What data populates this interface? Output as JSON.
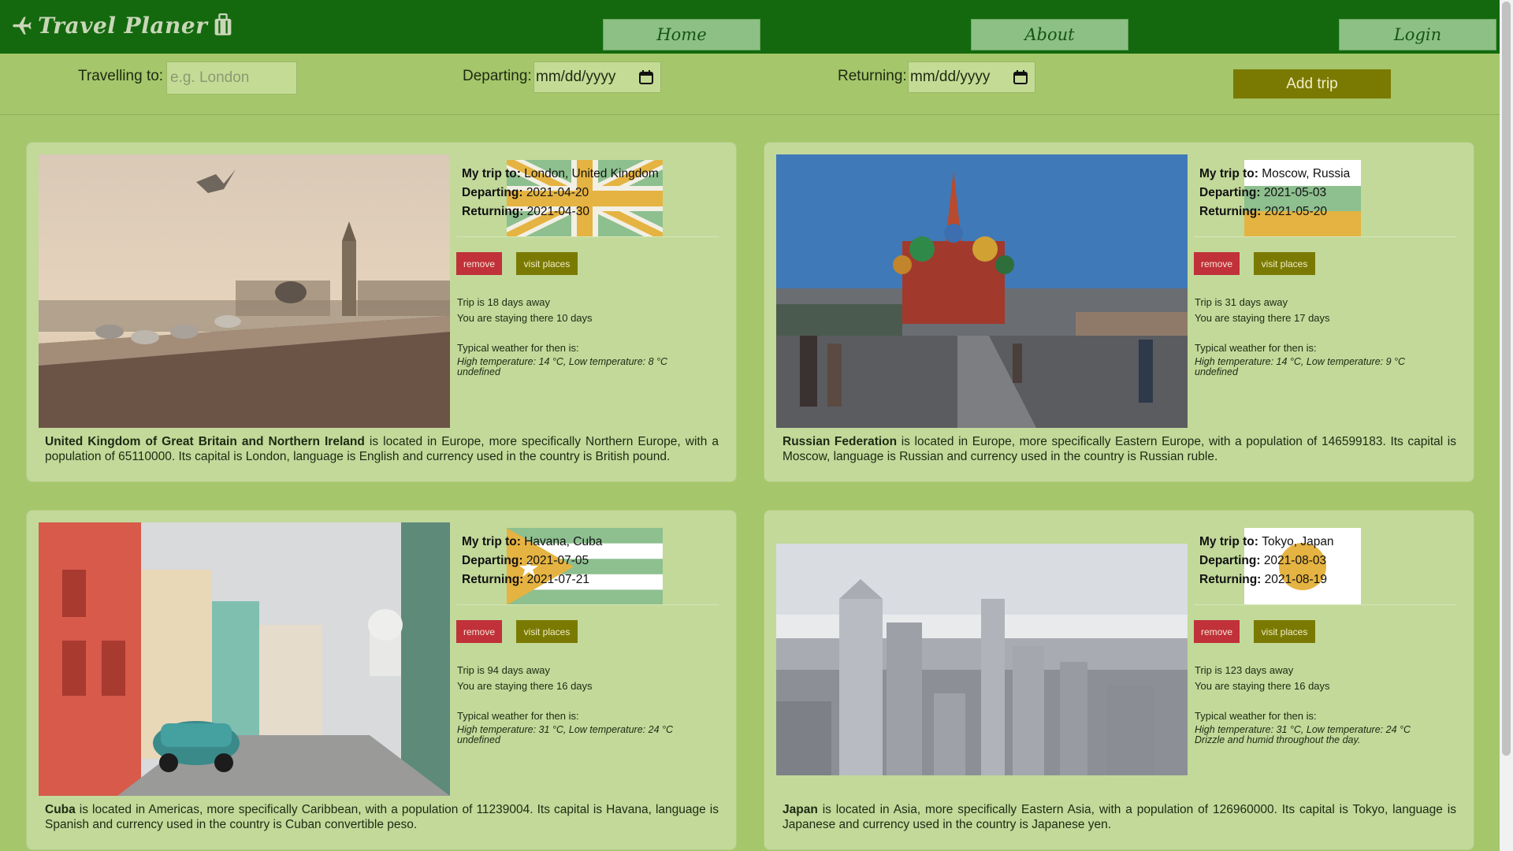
{
  "app": {
    "title": "Travel Planer"
  },
  "nav": {
    "home": "Home",
    "about": "About",
    "login": "Login"
  },
  "form": {
    "travelling_label": "Travelling to:",
    "travelling_placeholder": "e.g. London",
    "departing_label": "Departing:",
    "departing_value": "mm/dd/yyyy",
    "returning_label": "Returning:",
    "returning_value": "mm/dd/yyyy",
    "add_trip": "Add trip"
  },
  "labels": {
    "my_trip": "My trip to:",
    "departing": "Departing:",
    "returning": "Returning:",
    "remove": "remove",
    "visit_places": "visit places",
    "weather_heading": "Typical weather for then is:"
  },
  "trips": [
    {
      "destination": "London, United Kingdom",
      "departing": "2021-04-20",
      "returning": "2021-04-30",
      "away": "Trip is 18 days away",
      "staying": "You are staying there 10 days",
      "weather": "High temperature: 14 °C, Low temperature: 8 °C",
      "weather_desc": "undefined",
      "country": "United Kingdom of Great Britain and Northern Ireland",
      "description": " is located in Europe, more specifically Northern Europe, with a population of 65110000. Its capital is London, language is English and currency used in the country is British pound.",
      "flag": "uk"
    },
    {
      "destination": "Moscow, Russia",
      "departing": "2021-05-03",
      "returning": "2021-05-20",
      "away": "Trip is 31 days away",
      "staying": "You are staying there 17 days",
      "weather": "High temperature: 14 °C, Low temperature: 9 °C",
      "weather_desc": "undefined",
      "country": "Russian Federation",
      "description": " is located in Europe, more specifically Eastern Europe, with a population of 146599183. Its capital is Moscow, language is Russian and currency used in the country is Russian ruble.",
      "flag": "russia"
    },
    {
      "destination": "Havana, Cuba",
      "departing": "2021-07-05",
      "returning": "2021-07-21",
      "away": "Trip is 94 days away",
      "staying": "You are staying there 16 days",
      "weather": "High temperature: 31 °C, Low temperature: 24 °C",
      "weather_desc": "undefined",
      "country": "Cuba",
      "description": " is located in Americas, more specifically Caribbean, with a population of 11239004. Its capital is Havana, language is Spanish and currency used in the country is Cuban convertible peso.",
      "flag": "cuba"
    },
    {
      "destination": "Tokyo, Japan",
      "departing": "2021-08-03",
      "returning": "2021-08-19",
      "away": "Trip is 123 days away",
      "staying": "You are staying there 16 days",
      "weather": "High temperature: 31 °C, Low temperature: 24 °C",
      "weather_desc": "Drizzle and humid throughout the day.",
      "country": "Japan",
      "description": " is located in Asia, more specifically Eastern Asia, with a population of 126960000. Its capital is Tokyo, language is Japanese and currency used in the country is Japanese yen.",
      "flag": "japan"
    }
  ],
  "colors": {
    "header": "#14690e",
    "background": "#a5c66a",
    "card": "#c2d99a",
    "remove": "#c0313a",
    "accent": "#7a7a02",
    "flag_green": "#8dbf8f",
    "flag_gold": "#e5b341"
  },
  "icons": [
    "airplane-icon",
    "suitcase-icon",
    "calendar-icon"
  ]
}
